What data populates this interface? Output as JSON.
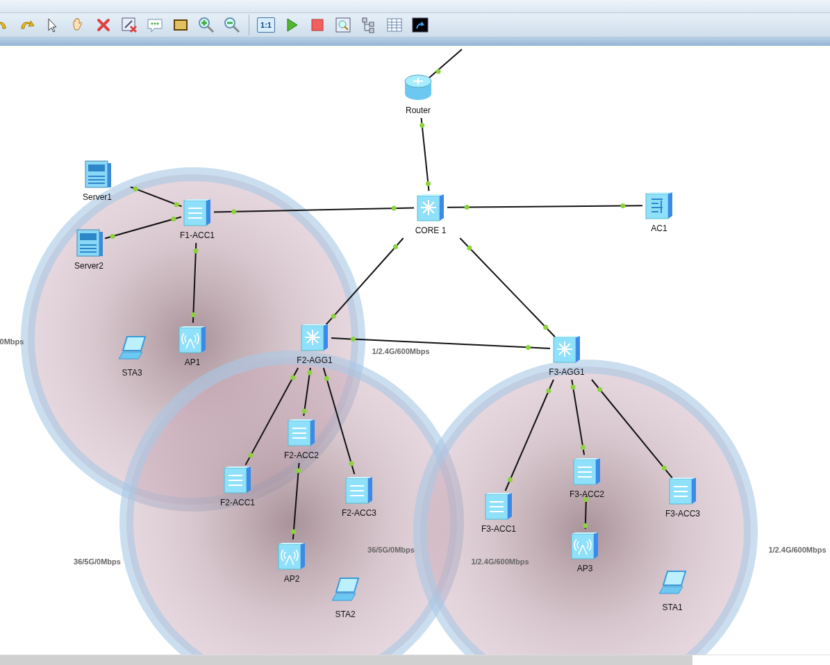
{
  "toolbar": {
    "buttons": [
      {
        "kind": "undo"
      },
      {
        "kind": "redo"
      },
      {
        "kind": "select"
      },
      {
        "kind": "pan"
      },
      {
        "kind": "delete"
      },
      {
        "kind": "delete-link"
      },
      {
        "kind": "comment"
      },
      {
        "kind": "rectangle"
      },
      {
        "kind": "zoom-in"
      },
      {
        "kind": "zoom-out"
      },
      {
        "kind": "actual-size",
        "label": "1:1"
      },
      {
        "kind": "start"
      },
      {
        "kind": "stop"
      },
      {
        "kind": "capture"
      },
      {
        "kind": "topology"
      },
      {
        "kind": "grid"
      },
      {
        "kind": "console"
      }
    ]
  },
  "topology": {
    "devices": [
      {
        "kind": "router",
        "name": "Router"
      },
      {
        "kind": "core",
        "name": "CORE 1"
      },
      {
        "kind": "server",
        "name": "Server1"
      },
      {
        "kind": "switch",
        "name": "F1-ACC1"
      },
      {
        "kind": "ac",
        "name": "AC1"
      },
      {
        "kind": "server",
        "name": "Server2"
      },
      {
        "kind": "ap",
        "name": "AP1"
      },
      {
        "kind": "laptop",
        "name": "STA3"
      },
      {
        "kind": "core",
        "name": "F2-AGG1"
      },
      {
        "kind": "core",
        "name": "F3-AGG1"
      },
      {
        "kind": "switch",
        "name": "F2-ACC2"
      },
      {
        "kind": "switch",
        "name": "F2-ACC1"
      },
      {
        "kind": "switch",
        "name": "F2-ACC3"
      },
      {
        "kind": "switch",
        "name": "F3-ACC1"
      },
      {
        "kind": "switch",
        "name": "F3-ACC2"
      },
      {
        "kind": "switch",
        "name": "F3-ACC3"
      },
      {
        "kind": "ap",
        "name": "AP2"
      },
      {
        "kind": "ap",
        "name": "AP3"
      },
      {
        "kind": "laptop",
        "name": "STA2"
      },
      {
        "kind": "laptop",
        "name": "STA1"
      }
    ],
    "link_labels": [
      "0Mbps",
      "1/2.4G/600Mbps",
      "36/5G/0Mbps",
      "36/5G/0Mbps",
      "1/2.4G/600Mbps",
      "1/2.4G/600Mbps"
    ]
  }
}
